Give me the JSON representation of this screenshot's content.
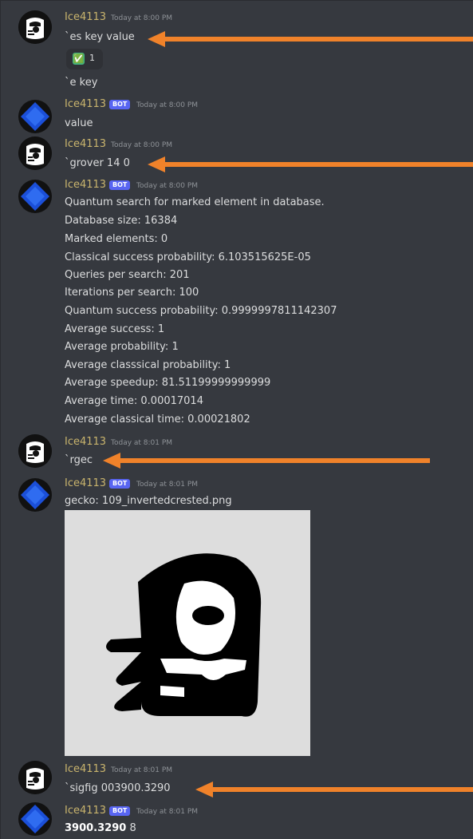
{
  "accent_colors": {
    "arrow": "#f0822a",
    "username": "#c9b46d",
    "bot_badge": "#5865f2",
    "background": "#36393f"
  },
  "messages": [
    {
      "username": "Ice4113",
      "timestamp": "Today at 8:00 PM",
      "lines": [
        "`es key value"
      ]
    },
    {
      "reaction": {
        "emoji": "✅",
        "count": "1"
      }
    },
    {
      "lines": [
        "`e key"
      ]
    },
    {
      "username": "Ice4113",
      "badge": "BOT",
      "timestamp": "Today at 8:00 PM",
      "lines": [
        "value"
      ]
    },
    {
      "username": "Ice4113",
      "timestamp": "Today at 8:00 PM",
      "lines": [
        "`grover 14 0"
      ]
    },
    {
      "username": "Ice4113",
      "badge": "BOT",
      "timestamp": "Today at 8:00 PM",
      "lines": [
        "Quantum search for marked element in database.",
        "Database size: 16384",
        "Marked elements: 0",
        "Classical success probability: 6.103515625E-05",
        "Queries per search: 201",
        "Iterations per search: 100",
        "Quantum success probability: 0.9999997811142307",
        "Average success: 1",
        "Average probability: 1",
        "Average classsical probability: 1",
        "Average speedup: 81.51199999999999",
        "Average time: 0.00017014",
        "Average classical time: 0.00021802"
      ]
    },
    {
      "username": "Ice4113",
      "timestamp": "Today at 8:01 PM",
      "lines": [
        "`rgec"
      ]
    },
    {
      "username": "Ice4113",
      "badge": "BOT",
      "timestamp": "Today at 8:01 PM",
      "lines": [
        "gecko: 109_invertedcrested.png"
      ]
    },
    {
      "username": "Ice4113",
      "timestamp": "Today at 8:01 PM",
      "lines": [
        "`sigfig 003900.3290"
      ]
    },
    {
      "username": "Ice4113",
      "badge": "BOT",
      "timestamp": "Today at 8:01 PM",
      "sigfig": {
        "value": "3900.3290",
        "count": "8"
      }
    }
  ]
}
